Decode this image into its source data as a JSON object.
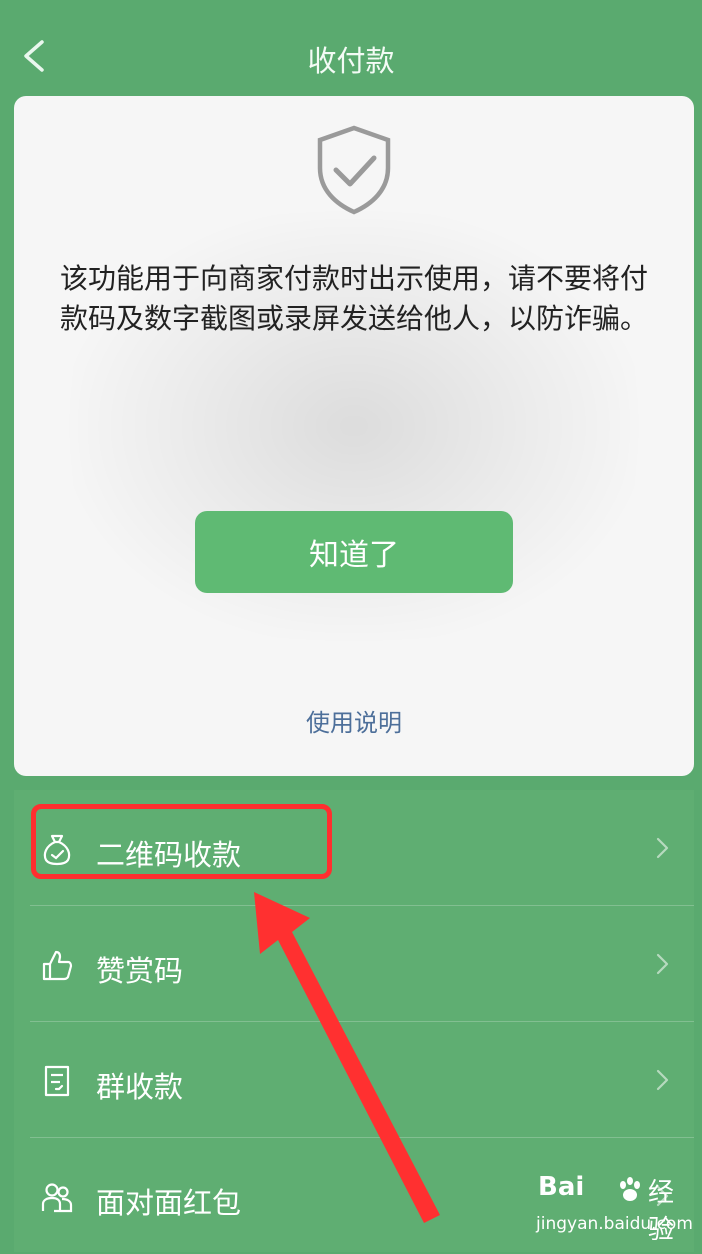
{
  "header": {
    "title": "收付款",
    "back_icon": "chevron-left-icon"
  },
  "notice_card": {
    "icon": "shield-check-icon",
    "message": "该功能用于向商家付款时出示使用，请不要将付款码及数字截图或录屏发送给他人，以防诈骗。",
    "confirm_label": "知道了",
    "help_link": "使用说明"
  },
  "menu": {
    "items": [
      {
        "label": "二维码收款",
        "icon": "money-bag-icon"
      },
      {
        "label": "赞赏码",
        "icon": "thumbs-up-icon"
      },
      {
        "label": "群收款",
        "icon": "document-icon"
      },
      {
        "label": "面对面红包",
        "icon": "people-icon"
      }
    ]
  },
  "annotation": {
    "highlight_color": "#ff2f2f",
    "arrow_color": "#ff3030"
  },
  "watermark": {
    "brand": "Bai",
    "text": "经验",
    "url": "jingyan.baidu.com"
  },
  "colors": {
    "primary_green": "#5aaa6f",
    "button_green": "#5fba73",
    "link_blue": "#4d6f9a"
  }
}
